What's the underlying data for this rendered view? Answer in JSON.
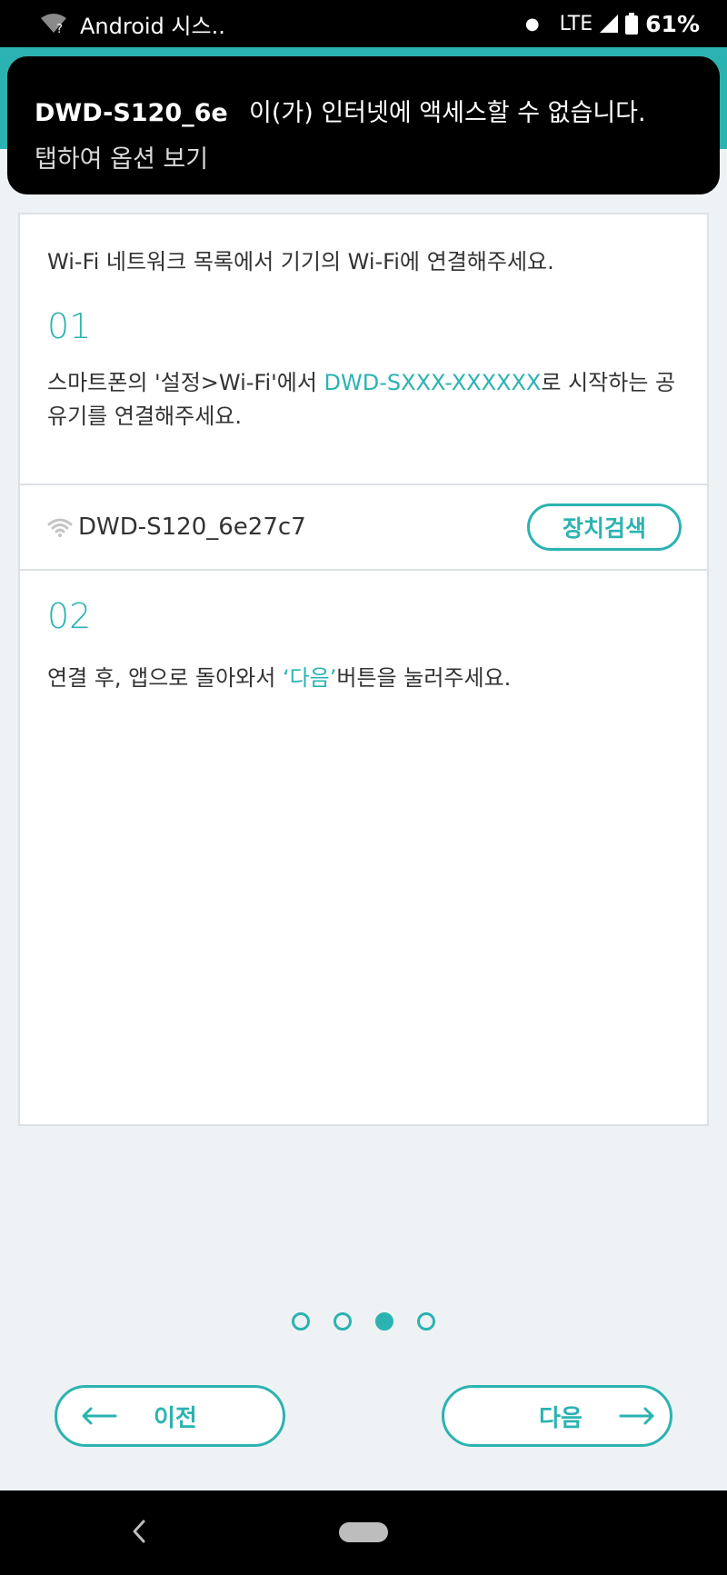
{
  "status_bar": {
    "notification_text": "Android 시스..",
    "network": "LTE",
    "battery": "61%"
  },
  "notification": {
    "device": "DWD-S120_6e",
    "message": "이(가) 인터넷에 액세스할 수 없습니다.",
    "sub": "탭하여 옵션 보기"
  },
  "card": {
    "intro": "Wi-Fi 네트워크 목록에서 기기의 Wi-Fi에 연결해주세요.",
    "step1": {
      "number": "01",
      "text_before": "스마트폰의 '설정>Wi-Fi'에서 ",
      "highlight": "DWD-SXXX-XXXXXX",
      "text_after": "로 시작하는 공유기를 연결해주세요."
    },
    "device_row": {
      "device_name": "DWD-S120_6e27c7",
      "search_label": "장치검색"
    },
    "step2": {
      "number": "02",
      "text_before": "연결 후, 앱으로 돌아와서 ",
      "highlight": "‘다음’",
      "text_after": "버튼을 눌러주세요."
    }
  },
  "pager": {
    "total": 4,
    "current": 3
  },
  "buttons": {
    "prev_label": "이전",
    "next_label": "다음"
  },
  "colors": {
    "accent": "#2bb3b1",
    "background": "#eef2f5"
  },
  "icons": [
    "wifi-question-icon",
    "wifi-icon",
    "signal-icon",
    "battery-icon",
    "arrow-left-icon",
    "arrow-right-icon",
    "back-icon"
  ]
}
